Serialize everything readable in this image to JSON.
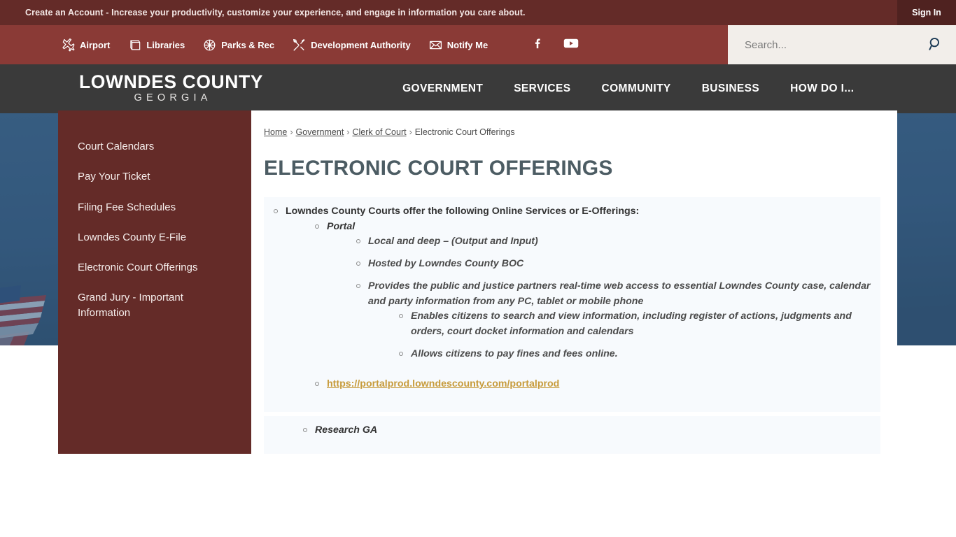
{
  "announcement": {
    "text": "Create an Account - Increase your productivity, customize your experience, and engage in information you care about.",
    "sign_in_label": "Sign In"
  },
  "utility": {
    "quick_links": [
      {
        "label": "Airport",
        "icon": "airplane-icon"
      },
      {
        "label": "Libraries",
        "icon": "book-icon"
      },
      {
        "label": "Parks & Rec",
        "icon": "sports-ball-icon"
      },
      {
        "label": "Development Authority",
        "icon": "tools-icon"
      },
      {
        "label": "Notify Me",
        "icon": "envelope-icon"
      }
    ],
    "social": [
      {
        "name": "facebook-icon",
        "label": "Facebook"
      },
      {
        "name": "youtube-icon",
        "label": "YouTube"
      }
    ],
    "search": {
      "placeholder": "Search...",
      "value": "",
      "button_icon": "search-icon"
    }
  },
  "header": {
    "logo_line1": "LOWNDES COUNTY",
    "logo_line2": "GEORGIA",
    "nav": [
      {
        "label": "GOVERNMENT"
      },
      {
        "label": "SERVICES"
      },
      {
        "label": "COMMUNITY"
      },
      {
        "label": "BUSINESS"
      },
      {
        "label": "HOW DO I..."
      }
    ]
  },
  "hero": {
    "alt": "Lowndes County courthouse dome with American flag against blue sky"
  },
  "sidebar": {
    "items": [
      {
        "label": "Court Calendars"
      },
      {
        "label": "Pay Your Ticket"
      },
      {
        "label": "Filing Fee Schedules"
      },
      {
        "label": "Lowndes County E-File"
      },
      {
        "label": "Electronic Court Offerings"
      },
      {
        "label": "Grand Jury - Important Information"
      }
    ]
  },
  "breadcrumb": {
    "items": [
      {
        "label": "Home",
        "link": true
      },
      {
        "label": "Government",
        "link": true
      },
      {
        "label": "Clerk of Court",
        "link": true
      },
      {
        "label": "Electronic Court Offerings",
        "link": false
      }
    ],
    "separator": "›"
  },
  "main": {
    "title": "ELECTRONIC COURT OFFERINGS",
    "intro": "Lowndes County Courts offer the following Online Services or E-Offerings:",
    "portal": {
      "heading": "Portal",
      "items": [
        "Local and deep – (Output and Input)",
        "Hosted by Lowndes County BOC",
        "Provides the public and justice partners real-time web access to essential Lowndes County case, calendar and party information from any PC, tablet or mobile phone"
      ],
      "sub_items": [
        "Enables citizens to search and view information, including register of actions, judgments and orders, court docket information and calendars",
        "Allows citizens to pay fines and fees online."
      ],
      "link": "https://portalprod.lowndescounty.com/portalprod"
    },
    "research_ga": {
      "heading": "Research GA"
    }
  },
  "colors": {
    "announce_bar": "#642b28",
    "utility_bar": "#8a3a36",
    "nav_bar": "#3a3a3a",
    "sidebar": "#642b28",
    "title": "#4c5c63",
    "link_gold": "#c79b3b",
    "panel": "#f7fafd"
  }
}
